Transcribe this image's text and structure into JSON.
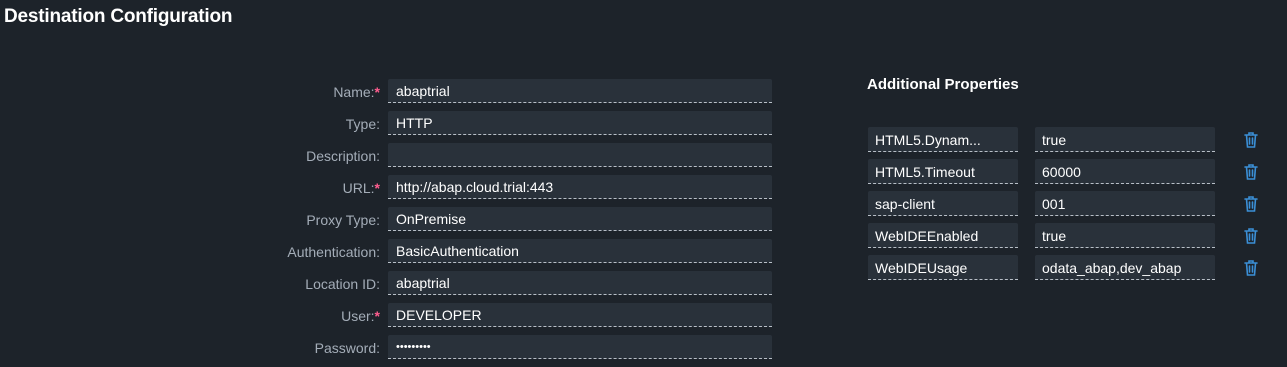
{
  "page": {
    "title": "Destination Configuration"
  },
  "form": {
    "fields": [
      {
        "label": "Name:",
        "required": "*",
        "value": "abaptrial"
      },
      {
        "label": "Type:",
        "required": "",
        "value": "HTTP"
      },
      {
        "label": "Description:",
        "required": "",
        "value": ""
      },
      {
        "label": "URL:",
        "required": "*",
        "value": "http://abap.cloud.trial:443"
      },
      {
        "label": "Proxy Type:",
        "required": "",
        "value": "OnPremise"
      },
      {
        "label": "Authentication:",
        "required": "",
        "value": "BasicAuthentication"
      },
      {
        "label": "Location ID:",
        "required": "",
        "value": "abaptrial"
      },
      {
        "label": "User:",
        "required": "*",
        "value": "DEVELOPER"
      },
      {
        "label": "Password:",
        "required": "",
        "value": "•••••••••"
      }
    ]
  },
  "additional_properties": {
    "title": "Additional Properties",
    "delete_icon": "trash-icon",
    "rows": [
      {
        "key": "HTML5.Dynam...",
        "value": "true"
      },
      {
        "key": "HTML5.Timeout",
        "value": "60000"
      },
      {
        "key": "sap-client",
        "value": "001"
      },
      {
        "key": "WebIDEEnabled",
        "value": "true"
      },
      {
        "key": "WebIDEUsage",
        "value": "odata_abap,dev_abap"
      }
    ]
  },
  "colors": {
    "background": "#1d232a",
    "field_bg": "#29313a",
    "label": "#a4adb8",
    "required": "#ff5d8f",
    "icon": "#3b8fd6"
  }
}
